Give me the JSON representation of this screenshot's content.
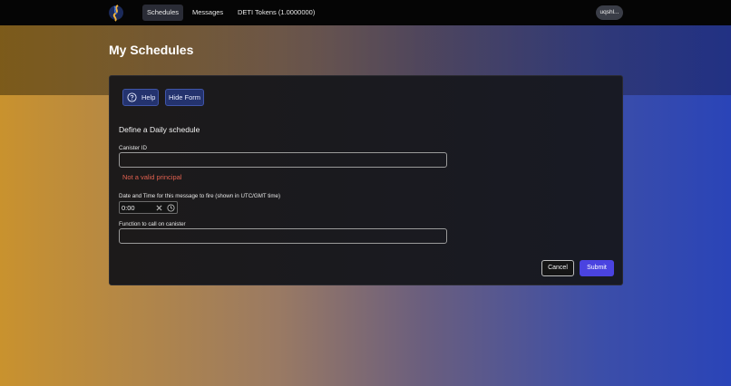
{
  "nav": {
    "items": [
      {
        "label": "Schedules",
        "active": true
      },
      {
        "label": "Messages",
        "active": false
      },
      {
        "label": "DETI Tokens (1.0000000)",
        "active": false
      }
    ],
    "user": "uqshl..."
  },
  "page": {
    "title": "My Schedules"
  },
  "form": {
    "help_label": "Help",
    "hide_label": "Hide Form",
    "heading": "Define a Daily schedule",
    "canister_label": "Canister ID",
    "canister_value": "",
    "canister_error": "Not a valid principal",
    "time_label": "Date and Time for this message to fire (shown in UTC/GMT time)",
    "time_value": "0:00",
    "function_label": "Function to call on canister",
    "function_value": "",
    "cancel_label": "Cancel",
    "submit_label": "Submit"
  },
  "colors": {
    "accent": "#4a43e0",
    "error": "#e0604f",
    "secondary_button": "#24336e"
  },
  "icons": {
    "logo": "app-logo",
    "help": "question-circle-icon",
    "clear": "clear-x-icon",
    "clock": "clock-icon"
  }
}
